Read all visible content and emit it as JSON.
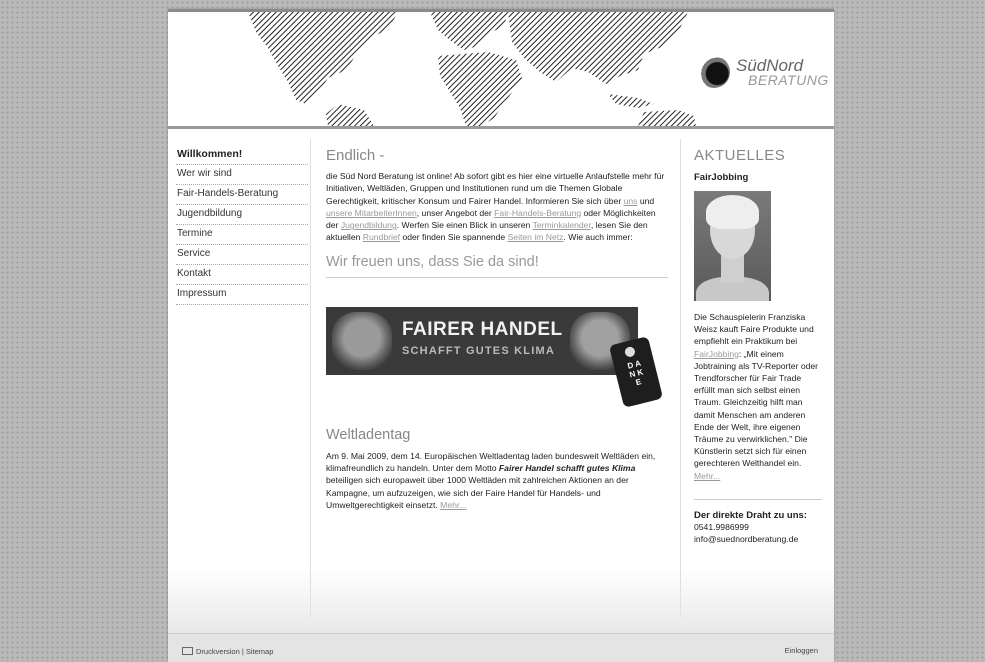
{
  "logo": {
    "line1": "SüdNord",
    "line2": "BERATUNG"
  },
  "nav": {
    "items": [
      {
        "label": "Willkommen!"
      },
      {
        "label": "Wer wir sind"
      },
      {
        "label": "Fair-Handels-Beratung"
      },
      {
        "label": "Jugendbildung"
      },
      {
        "label": "Termine"
      },
      {
        "label": "Service"
      },
      {
        "label": "Kontakt"
      },
      {
        "label": "Impressum"
      }
    ]
  },
  "main": {
    "heading": "Endlich -",
    "intro": {
      "p1": "die Süd Nord Beratung ist online! Ab sofort gibt es hier eine virtuelle Anlaufstelle mehr für Initiativen, Weltläden, Gruppen und Institutionen rund um die Themen Globale Gerechtigkeit, kritischer Konsum und Fairer Handel. Informieren Sie sich über ",
      "link_uns": "uns",
      "p2": " und ",
      "link_mitarbeiter": "unsere MitarbeiterInnen",
      "p3": ", unser Angebot der ",
      "link_fair": "Fair-Handels-Beratung",
      "p4": " oder Möglichkeiten der ",
      "link_jugend": "Jugendbildung",
      "p5": ". Werfen Sie einen Blick in unseren ",
      "link_termin": "Terminkalender",
      "p6": ", lesen Sie den aktuellen ",
      "link_rund": "Rundbrief",
      "p7": " oder finden Sie spannende ",
      "link_seiten": "Seiten im Netz",
      "p8": ". Wie auch immer:"
    },
    "subheading": "Wir freuen uns, dass Sie da sind!",
    "banner": {
      "line1": "FAIRER HANDEL",
      "line2": "SCHAFFT GUTES KLIMA",
      "tag": "D A N K E"
    },
    "weltladentag": {
      "heading": "Weltladentag",
      "t1": "Am 9. Mai 2009, dem 14. Europäischen Weltladentag laden bundesweit Weltläden ein, klimafreundlich zu handeln. Unter dem Motto ",
      "motto": "Fairer Handel schafft gutes Klima",
      "t2": " beteiligen sich europaweit über 1000 Weltläden mit zahlreichen Aktionen an der Kampagne, um aufzuzeigen, wie sich der Faire Handel für Handels- und Umweltgerechtigkeit einsetzt. ",
      "more": "Mehr..."
    }
  },
  "aktuelles": {
    "heading": "AKTUELLES",
    "title": "FairJobbing",
    "t1": "Die Schauspielerin Franziska Weisz kauft Faire Produkte und empfiehlt ein Praktikum bei ",
    "link": "FairJobbing",
    "t2": ": „Mit einem Jobtraining als TV-Reporter oder Trendforscher für Fair Trade erfüllt man sich selbst einen Traum. Gleichzeitig hilft man damit Menschen am anderen Ende der Welt, ihre eigenen Träume zu verwirklichen.\" Die Künstlerin setzt sich für einen gerechteren Welthandel ein. ",
    "more": "Mehr..."
  },
  "contact": {
    "heading": "Der direkte Draht zu uns:",
    "phone": "0541.9986999",
    "email": "info@suednordberatung.de"
  },
  "footer": {
    "left": "Druckversion | Sitemap",
    "right": "Einloggen"
  },
  "colors": {
    "background": "#b9b9b9",
    "link": "#999999",
    "heading": "#888888"
  }
}
